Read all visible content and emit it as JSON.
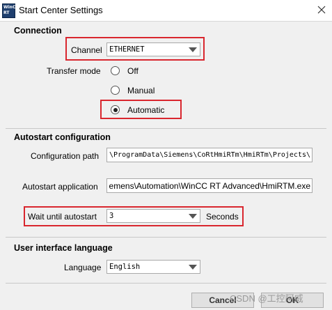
{
  "window": {
    "title": "Start Center Settings",
    "icon_text_line1": "WinCC",
    "icon_text_line2": "RT"
  },
  "connection": {
    "header": "Connection",
    "channel_label": "Channel",
    "channel_value": "ETHERNET",
    "transfer_mode_label": "Transfer mode",
    "transfer_modes": [
      {
        "label": "Off",
        "selected": false
      },
      {
        "label": "Manual",
        "selected": false
      },
      {
        "label": "Automatic",
        "selected": true
      }
    ]
  },
  "autostart": {
    "header": "Autostart configuration",
    "config_path_label": "Configuration path",
    "config_path_value": "\\ProgramData\\Siemens\\CoRtHmiRTm\\HmiRTm\\Projects\\",
    "app_label": "Autostart application",
    "app_value": "emens\\Automation\\WinCC RT Advanced\\HmiRTM.exe",
    "wait_label": "Wait until autostart",
    "wait_value": "3",
    "wait_unit": "Seconds"
  },
  "ui_language": {
    "header": "User interface language",
    "language_label": "Language",
    "language_value": "English"
  },
  "buttons": {
    "cancel": "Cancel",
    "ok": "OK"
  },
  "watermark": "CSDN @工控阿威",
  "colors": {
    "highlight": "#d9262e",
    "background": "#f0f0f0"
  }
}
